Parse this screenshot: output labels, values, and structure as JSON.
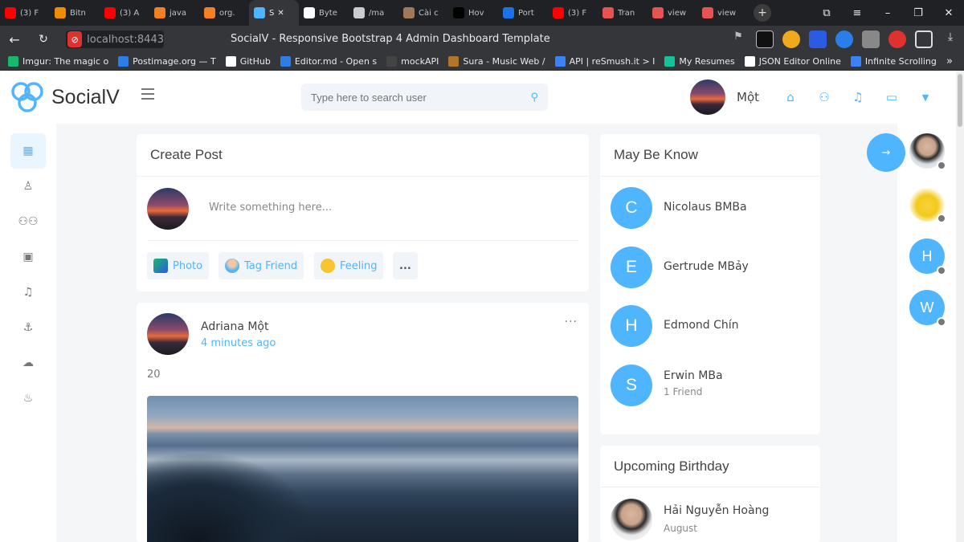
{
  "browser": {
    "tabs": [
      {
        "label": "(3) F",
        "icon_color": "#ff0000"
      },
      {
        "label": "Bitn",
        "icon_color": "#f08c00"
      },
      {
        "label": "(3) A",
        "icon_color": "#ff0000"
      },
      {
        "label": "java",
        "icon_color": "#f48024"
      },
      {
        "label": "org.",
        "icon_color": "#f48024"
      },
      {
        "label": "S",
        "icon_color": "#50b5ff",
        "active": true
      },
      {
        "label": "Byte",
        "icon_color": "#ffffff"
      },
      {
        "label": "/ma",
        "icon_color": "#cccccc"
      },
      {
        "label": "Cài c",
        "icon_color": "#a0785a"
      },
      {
        "label": "Hov",
        "icon_color": "#000000"
      },
      {
        "label": "Port",
        "icon_color": "#1a73e8"
      },
      {
        "label": "(3) F",
        "icon_color": "#ff0000"
      },
      {
        "label": "Tran",
        "icon_color": "#e55353"
      },
      {
        "label": "view",
        "icon_color": "#e55353"
      },
      {
        "label": "view",
        "icon_color": "#e55353"
      }
    ],
    "new_tab_symbol": "+",
    "address": "localhost:8443",
    "page_title": "SocialV - Responsive Bootstrap 4 Admin Dashboard Template",
    "bookmarks": [
      {
        "label": "Imgur: The magic o",
        "icon_color": "#1bb76e"
      },
      {
        "label": "Postimage.org — T",
        "icon_color": "#2b7de9"
      },
      {
        "label": "GitHub",
        "icon_color": "#ffffff"
      },
      {
        "label": "Editor.md - Open s",
        "icon_color": "#2b7de9"
      },
      {
        "label": "mockAPI",
        "icon_color": "#444444"
      },
      {
        "label": "Sura - Music Web /",
        "icon_color": "#b0772a"
      },
      {
        "label": "API | reSmush.it > I",
        "icon_color": "#3b82f6"
      },
      {
        "label": "My Resumes",
        "icon_color": "#15c39a"
      },
      {
        "label": "JSON Editor Online",
        "icon_color": "#ffffff"
      },
      {
        "label": "Infinite Scrolling",
        "icon_color": "#3b82f6"
      }
    ]
  },
  "app": {
    "brand": "SocialV",
    "search_placeholder": "Type here to search user",
    "user_name": "Một"
  },
  "create_post": {
    "title": "Create Post",
    "placeholder": "Write something here...",
    "actions": [
      "Photo",
      "Tag Friend",
      "Feeling",
      "..."
    ]
  },
  "post": {
    "author": "Adriana Một",
    "time": "4 minutes ago",
    "text": "20",
    "more": "···"
  },
  "may_be_know": {
    "title": "May Be Know",
    "people": [
      {
        "initial": "C",
        "name": "Nicolaus BMBa",
        "sub": ""
      },
      {
        "initial": "E",
        "name": "Gertrude MBảy",
        "sub": ""
      },
      {
        "initial": "H",
        "name": "Edmond Chín",
        "sub": ""
      },
      {
        "initial": "S",
        "name": "Erwin MBa",
        "sub": "1 Friend"
      }
    ]
  },
  "birthday": {
    "title": "Upcoming Birthday",
    "name": "Hải Nguyễn Hoàng",
    "month": "August"
  },
  "chat_sidebar": {
    "users": [
      {
        "type": "photo"
      },
      {
        "type": "pikachu"
      },
      {
        "type": "letter",
        "initial": "H"
      },
      {
        "type": "letter",
        "initial": "W"
      }
    ]
  },
  "colors": {
    "accent": "#50b5ff",
    "status_dot": "#777777"
  }
}
